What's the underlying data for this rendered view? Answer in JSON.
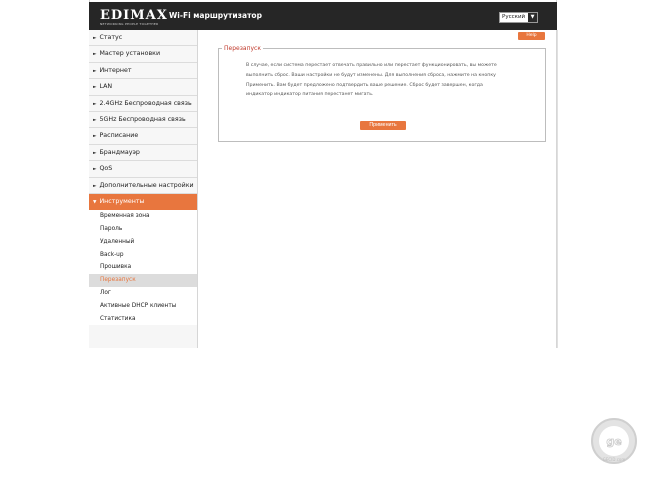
{
  "header": {
    "logo": "EDIMAX",
    "logo_tagline": "NETWORKING PEOPLE TOGETHER",
    "product": "Wi-Fi маршрутизатор",
    "language": "Русский"
  },
  "sidebar": {
    "items": [
      {
        "label": "Статус"
      },
      {
        "label": "Мастер установки"
      },
      {
        "label": "Интернет"
      },
      {
        "label": "LAN"
      },
      {
        "label": "2.4GHz Беспроводная связь"
      },
      {
        "label": "5GHz Беспроводная связь"
      },
      {
        "label": "Расписание"
      },
      {
        "label": "Брандмауэр"
      },
      {
        "label": "QoS"
      },
      {
        "label": "Дополнительные настройки"
      },
      {
        "label": "Инструменты"
      }
    ],
    "subitems": [
      {
        "label": "Временная зона"
      },
      {
        "label": "Пароль"
      },
      {
        "label": "Удаленный"
      },
      {
        "label": "Back-up"
      },
      {
        "label": "Прошивка"
      },
      {
        "label": "Перезапуск"
      },
      {
        "label": "Лог"
      },
      {
        "label": "Активные DHCP клиенты"
      },
      {
        "label": "Статистика"
      }
    ]
  },
  "main": {
    "help_label": "Help",
    "section_title": "Перезапуск",
    "description": "В случае, если система перестает отвечать правильно или перестает функционировать, вы можете выполнить сброс. Ваши настройки не будут изменены. Для выполнения сброса, нажмите на кнопку Применить. Вам будет предложено подтвердить ваше решение. Сброс будет завершен, когда индикатор индикатор питания перестанет мигать.",
    "apply_label": "Применить"
  },
  "watermark": {
    "text": "GECID.com"
  },
  "colors": {
    "accent": "#e8763e",
    "topbar": "#262626",
    "legend": "#c0392b"
  }
}
